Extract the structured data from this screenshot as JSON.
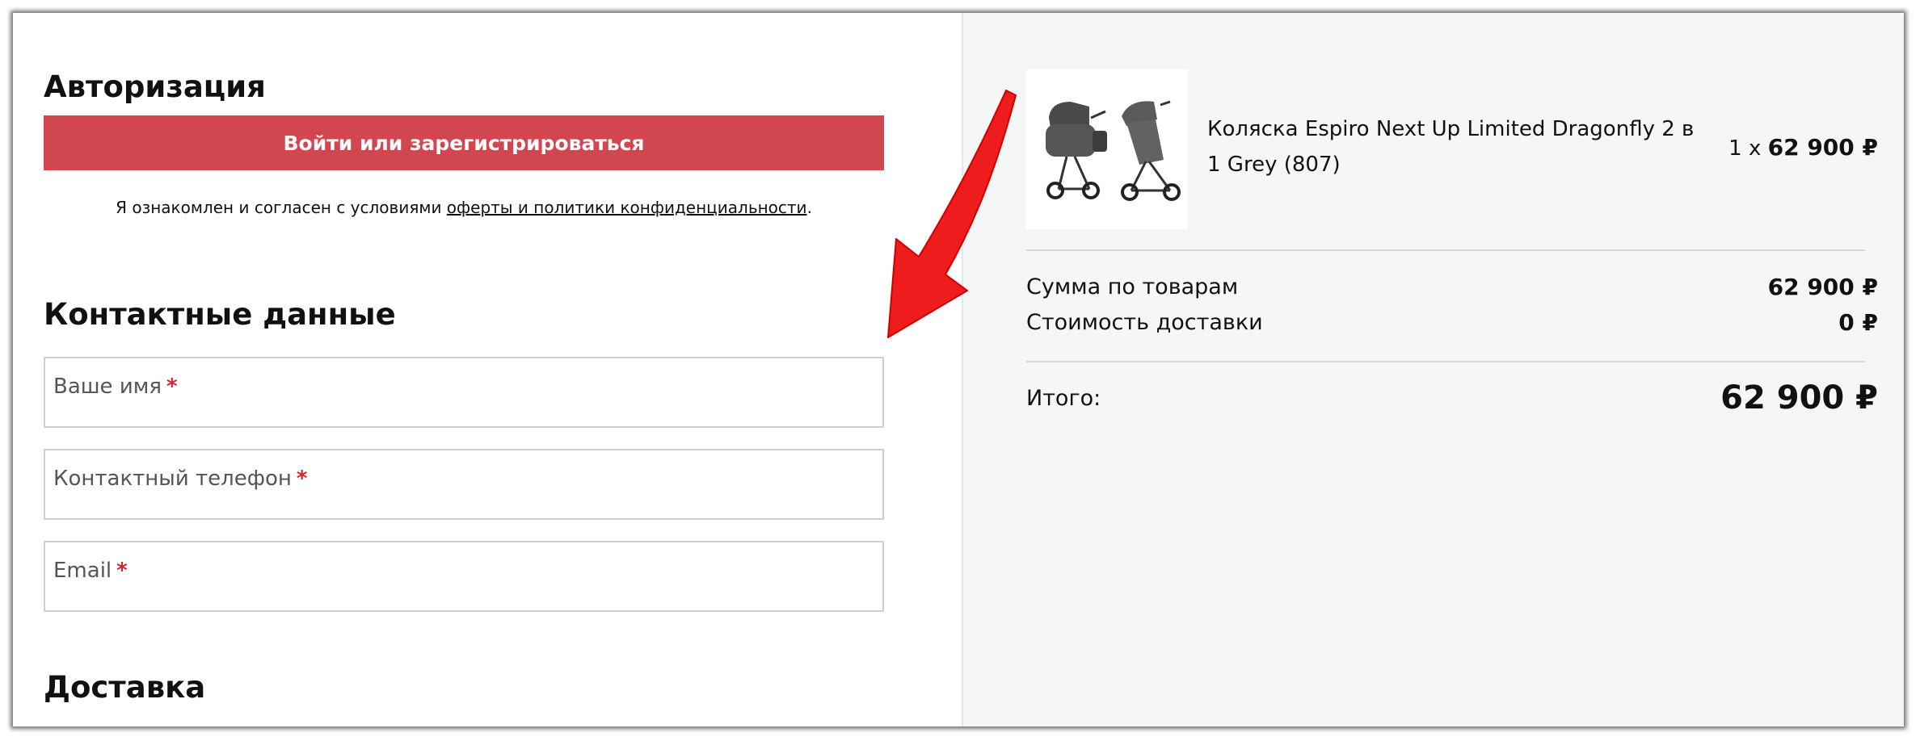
{
  "auth": {
    "title": "Авторизация",
    "login_button": "Войти или зарегистрироваться",
    "agreement_prefix": "Я ознакомлен и согласен с условиями ",
    "agreement_link": "оферты и политики конфиденциальности",
    "agreement_suffix": "."
  },
  "contacts": {
    "title": "Контактные данные",
    "fields": [
      {
        "label": "Ваше имя",
        "required_mark": "*"
      },
      {
        "label": "Контактный телефон",
        "required_mark": "*"
      },
      {
        "label": "Email",
        "required_mark": "*"
      }
    ]
  },
  "delivery": {
    "title": "Доставка"
  },
  "order": {
    "item": {
      "title": "Коляска Espiro Next Up Limited Dragonfly 2 в 1 Grey (807)",
      "qty_prefix": "1 x",
      "price": "62 900 ₽"
    },
    "summary": {
      "goods_label": "Сумма по товарам",
      "goods_value": "62 900 ₽",
      "delivery_label": "Стоимость доставки",
      "delivery_value": "0 ₽",
      "total_label": "Итого:",
      "total_value": "62 900 ₽"
    }
  },
  "colors": {
    "accent": "#d2474f",
    "required": "#d2242f",
    "annotation_arrow": "#ee1c1c",
    "sidebar_bg": "#f5f6f8"
  },
  "icons": {
    "annotation": "red-arrow-icon",
    "product": "stroller-image"
  }
}
